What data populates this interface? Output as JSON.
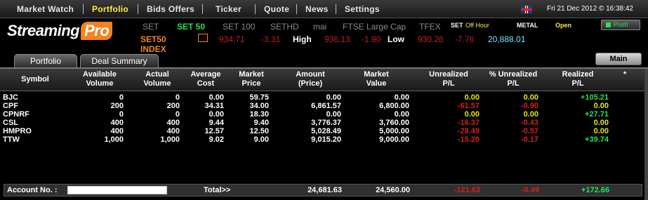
{
  "menu": {
    "items": [
      "Market Watch",
      "Portfolio",
      "Bids Offers",
      "Ticker",
      "Quote",
      "News",
      "Settings"
    ],
    "active": "Portfolio"
  },
  "header": {
    "flag_icon": "uk-flag-icon",
    "datetime": "Fri 21 Dec 2012  © 16:38:42"
  },
  "logo": {
    "text": "Streaming",
    "pro": "Pro"
  },
  "indices": [
    "SET",
    "SET 50",
    "SET 100",
    "SETHD",
    "mai",
    "FTSE Large Cap",
    "TFEX"
  ],
  "active_index": "SET 50",
  "status": {
    "set_label": "SET",
    "set_status": "Off Hour",
    "metal_label": "METAL",
    "metal_status": "Open",
    "push_label": "Push"
  },
  "quote": {
    "name": "SET50 INDEX",
    "last": "934.71",
    "change": "-3.31",
    "high_label": "High",
    "high": "936.13",
    "high_change": "-1.90",
    "low_label": "Low",
    "low": "930.26",
    "low_change": "-7.76",
    "volume": "20,888.01"
  },
  "tabs": [
    "Portfolio",
    "Deal Summary"
  ],
  "main_button": "Main",
  "columns": [
    {
      "l1": "Symbol",
      "l2": ""
    },
    {
      "l1": "Available",
      "l2": "Volume"
    },
    {
      "l1": "Actual",
      "l2": "Volume"
    },
    {
      "l1": "Average",
      "l2": "Cost"
    },
    {
      "l1": "Market",
      "l2": "Price"
    },
    {
      "l1": "Amount",
      "l2": "(Price)"
    },
    {
      "l1": "Market",
      "l2": "Value"
    },
    {
      "l1": "Unrealized",
      "l2": "P/L"
    },
    {
      "l1": "% Unrealized",
      "l2": "P/L"
    },
    {
      "l1": "Realized",
      "l2": "P/L"
    },
    {
      "l1": "*",
      "l2": ""
    }
  ],
  "rows": [
    {
      "symbol": "BJC",
      "avail": "0",
      "actual": "0",
      "avg": "0.00",
      "price": "59.75",
      "amount": "0.00",
      "value": "0.00",
      "upl": "0.00",
      "upl_pct": "0.00",
      "rpl": "+105.21",
      "upl_color": "#e8e800",
      "rpl_color": "#25e25a"
    },
    {
      "symbol": "CPF",
      "avail": "200",
      "actual": "200",
      "avg": "34.31",
      "price": "34.00",
      "amount": "6,861.57",
      "value": "6,800.00",
      "upl": "-61.57",
      "upl_pct": "-0.90",
      "rpl": "0.00",
      "upl_color": "#d42020",
      "rpl_color": "#e8e800"
    },
    {
      "symbol": "CPNRF",
      "avail": "0",
      "actual": "0",
      "avg": "0.00",
      "price": "18.30",
      "amount": "0.00",
      "value": "0.00",
      "upl": "0.00",
      "upl_pct": "0.00",
      "rpl": "+27.71",
      "upl_color": "#e8e800",
      "rpl_color": "#25e25a"
    },
    {
      "symbol": "CSL",
      "avail": "400",
      "actual": "400",
      "avg": "9.44",
      "price": "9.40",
      "amount": "3,776.37",
      "value": "3,760.00",
      "upl": "-16.37",
      "upl_pct": "-0.43",
      "rpl": "0.00",
      "upl_color": "#d42020",
      "rpl_color": "#e8e800"
    },
    {
      "symbol": "HMPRO",
      "avail": "400",
      "actual": "400",
      "avg": "12.57",
      "price": "12.50",
      "amount": "5,028.49",
      "value": "5,000.00",
      "upl": "-28.49",
      "upl_pct": "-0.57",
      "rpl": "0.00",
      "upl_color": "#d42020",
      "rpl_color": "#e8e800"
    },
    {
      "symbol": "TTW",
      "avail": "1,000",
      "actual": "1,000",
      "avg": "9.02",
      "price": "9.00",
      "amount": "9,015.20",
      "value": "9,000.00",
      "upl": "-15.20",
      "upl_pct": "-0.17",
      "rpl": "+39.74",
      "upl_color": "#d42020",
      "rpl_color": "#25e25a"
    }
  ],
  "footer": {
    "account_label": "Account No. :",
    "account_value": "",
    "total_label": "Total>>",
    "total_amount": "24,681.63",
    "total_value": "24,560.00",
    "total_upl": "-121.63",
    "total_upl_pct": "-0.49",
    "total_rpl": "+172.66"
  },
  "colors": {
    "accent_orange": "#f58220",
    "positive": "#25e25a",
    "negative": "#d42020",
    "neutral": "#e8e800",
    "active_menu": "#ffef3a"
  }
}
